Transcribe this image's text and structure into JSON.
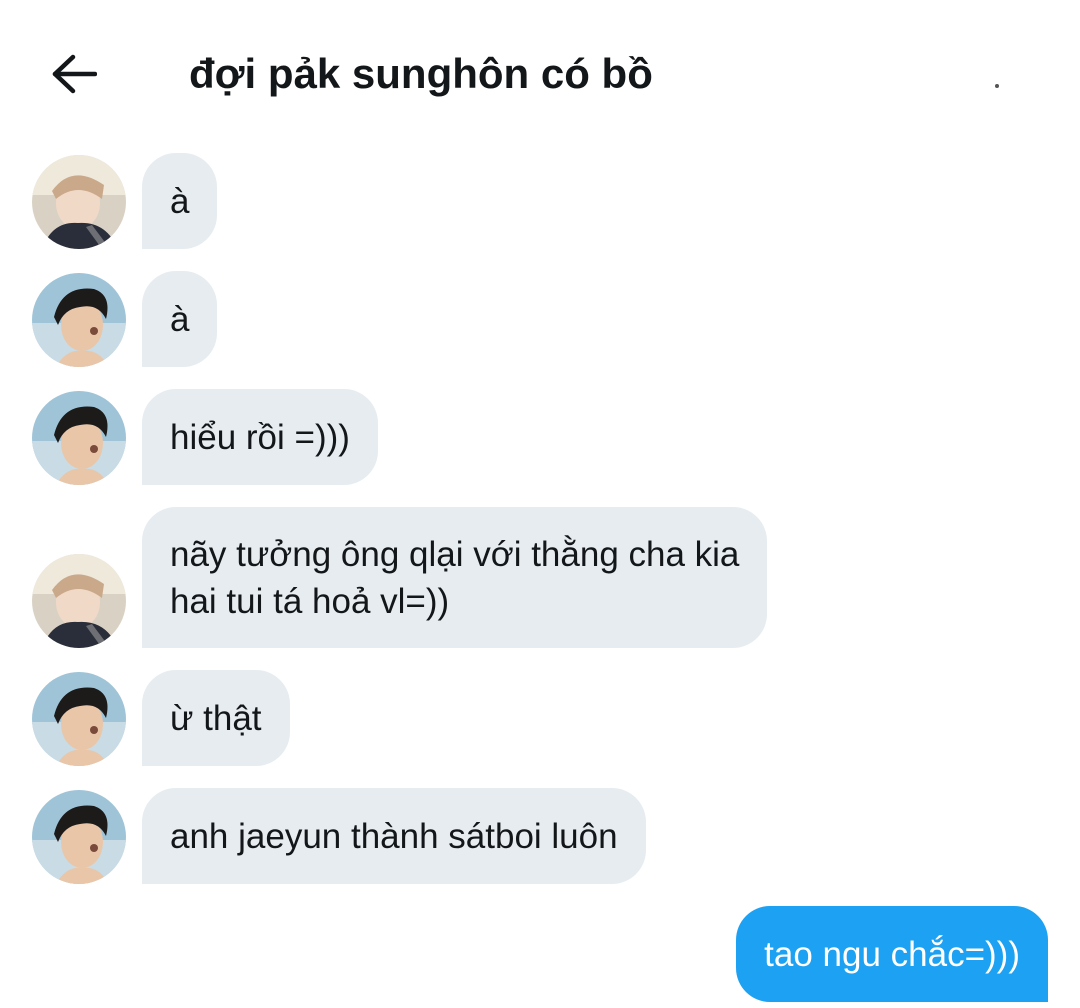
{
  "header": {
    "title": "đợi pảk sunghôn có bồ",
    "back_icon": "arrow-left-icon"
  },
  "colors": {
    "incoming_bubble": "#e6ecf0",
    "outgoing_bubble": "#1da1f2",
    "text": "#14171a"
  },
  "messages": [
    {
      "sender": "avatar-a",
      "text": "à"
    },
    {
      "sender": "avatar-b",
      "text": "à"
    },
    {
      "sender": "avatar-b",
      "text": "hiểu rồi =)))"
    },
    {
      "sender": "avatar-a",
      "lines": [
        "nãy tưởng ông qlại với thằng cha kia",
        "hai tui tá hoả vl=))"
      ]
    },
    {
      "sender": "avatar-b",
      "text": "ừ thật"
    },
    {
      "sender": "avatar-b",
      "text": "anh jaeyun thành sátboi luôn"
    },
    {
      "sender": "self",
      "text": "tao ngu chắc=)))"
    }
  ]
}
